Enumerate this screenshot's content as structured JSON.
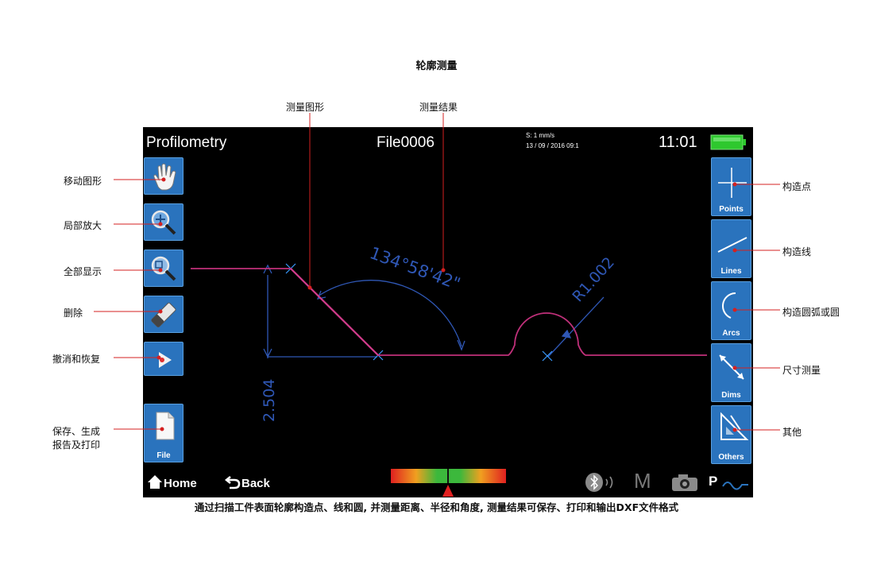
{
  "page_title": "轮廓测量",
  "caption": "通过扫描工件表面轮廓构造点、线和圆, 并测量距离、半径和角度, 测量结果可保存、打印和输出DXF文件格式",
  "callouts": {
    "measure_shape": "测量图形",
    "measure_result": "测量结果",
    "move_shape": "移动图形",
    "zoom_local": "局部放大",
    "show_all": "全部显示",
    "delete": "删除",
    "undo_redo": "撤消和恢复",
    "file_line1": "保存、生成",
    "file_line2": "报告及打印",
    "points": "构造点",
    "lines": "构造线",
    "arcs": "构造圆弧或圆",
    "dims": "尺寸测量",
    "others": "其他"
  },
  "screen": {
    "app_title": "Profilometry",
    "file_name": "File0006",
    "speed": "S: 1 mm/s",
    "datetime": "13 / 09 / 2016  09:1",
    "clock": "11:01",
    "battery_color": "#2ec82e",
    "right_tools": [
      {
        "label": "Points",
        "icon": "crosshair-icon"
      },
      {
        "label": "Lines",
        "icon": "line-icon"
      },
      {
        "label": "Arcs",
        "icon": "arc-icon"
      },
      {
        "label": "Dims",
        "icon": "dimension-icon"
      },
      {
        "label": "Others",
        "icon": "triangle-ruler-icon"
      }
    ],
    "left_tools": [
      {
        "icon": "hand-icon"
      },
      {
        "icon": "zoom-in-icon"
      },
      {
        "icon": "zoom-fit-icon"
      },
      {
        "icon": "eraser-icon"
      },
      {
        "icon": "undo-redo-icon"
      },
      {
        "label": "File",
        "icon": "file-icon"
      }
    ],
    "footer": {
      "home": "Home",
      "back": "Back",
      "mode_letter": "M",
      "profile_letter": "P"
    },
    "measurements": {
      "angle": "134°58'42\"",
      "height": "2.504",
      "radius": "R1.002"
    },
    "colors": {
      "accent": "#2a73bd",
      "profile": "#c0307a",
      "dimension": "#2f57b5"
    }
  }
}
